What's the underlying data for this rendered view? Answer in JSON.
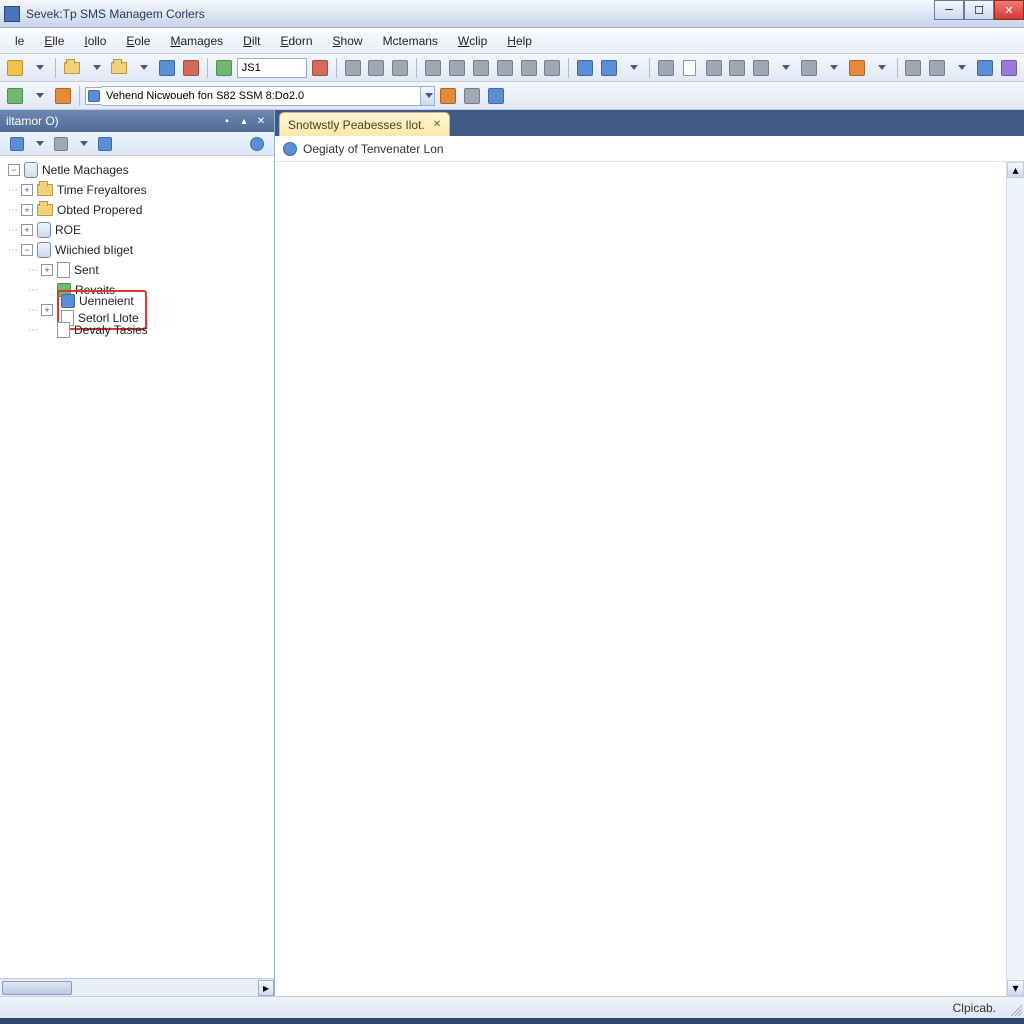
{
  "window": {
    "title": "Sevek:Tp SMS Managem Corlers"
  },
  "menubar": {
    "items": [
      {
        "label": "le",
        "u": ""
      },
      {
        "label": "Elle",
        "u": "E"
      },
      {
        "label": "Iollo",
        "u": "I"
      },
      {
        "label": "Eole",
        "u": "E"
      },
      {
        "label": "Mamages",
        "u": "M"
      },
      {
        "label": "Dilt",
        "u": "D"
      },
      {
        "label": "Edorn",
        "u": "E"
      },
      {
        "label": "Show",
        "u": "S"
      },
      {
        "label": "Mctemans",
        "u": ""
      },
      {
        "label": "Wclip",
        "u": "W"
      },
      {
        "label": "Help",
        "u": "H"
      }
    ]
  },
  "toolbar1": {
    "search_value": "JS1"
  },
  "addressbar": {
    "value": "Vehend Nicwoueh fon S82 SSM 8:Do2.0"
  },
  "sidebar": {
    "title": "iltamor O)",
    "tree": [
      {
        "label": "Netle Machages",
        "level": 1,
        "exp": "-",
        "icon": "db"
      },
      {
        "label": "Time Freyaltores",
        "level": 1,
        "exp": "+",
        "icon": "folder"
      },
      {
        "label": "Obted Propered",
        "level": 1,
        "exp": "+",
        "icon": "folder"
      },
      {
        "label": "ROE",
        "level": 1,
        "exp": "+",
        "icon": "db"
      },
      {
        "label": "Wiichied bIiget",
        "level": 1,
        "exp": "-",
        "icon": "db"
      },
      {
        "label": "Sent",
        "level": 2,
        "exp": "+",
        "icon": "page"
      },
      {
        "label": "Revaits",
        "level": 2,
        "exp": "",
        "icon": "block-g"
      },
      {
        "label": "Uenneient",
        "level": 2,
        "exp": "+",
        "icon": "block-b",
        "highlight": true
      },
      {
        "label": "Setorl Llote",
        "level": 2,
        "exp": "",
        "icon": "page",
        "highlight": true
      },
      {
        "label": "Devaly Tasies",
        "level": 2,
        "exp": "",
        "icon": "page"
      }
    ]
  },
  "content": {
    "tab_label": "Snotwstly Peabesses Ilot.",
    "crumb": "Oegiaty of Tenvenater Lon"
  },
  "statusbar": {
    "text": "Clpicab."
  }
}
